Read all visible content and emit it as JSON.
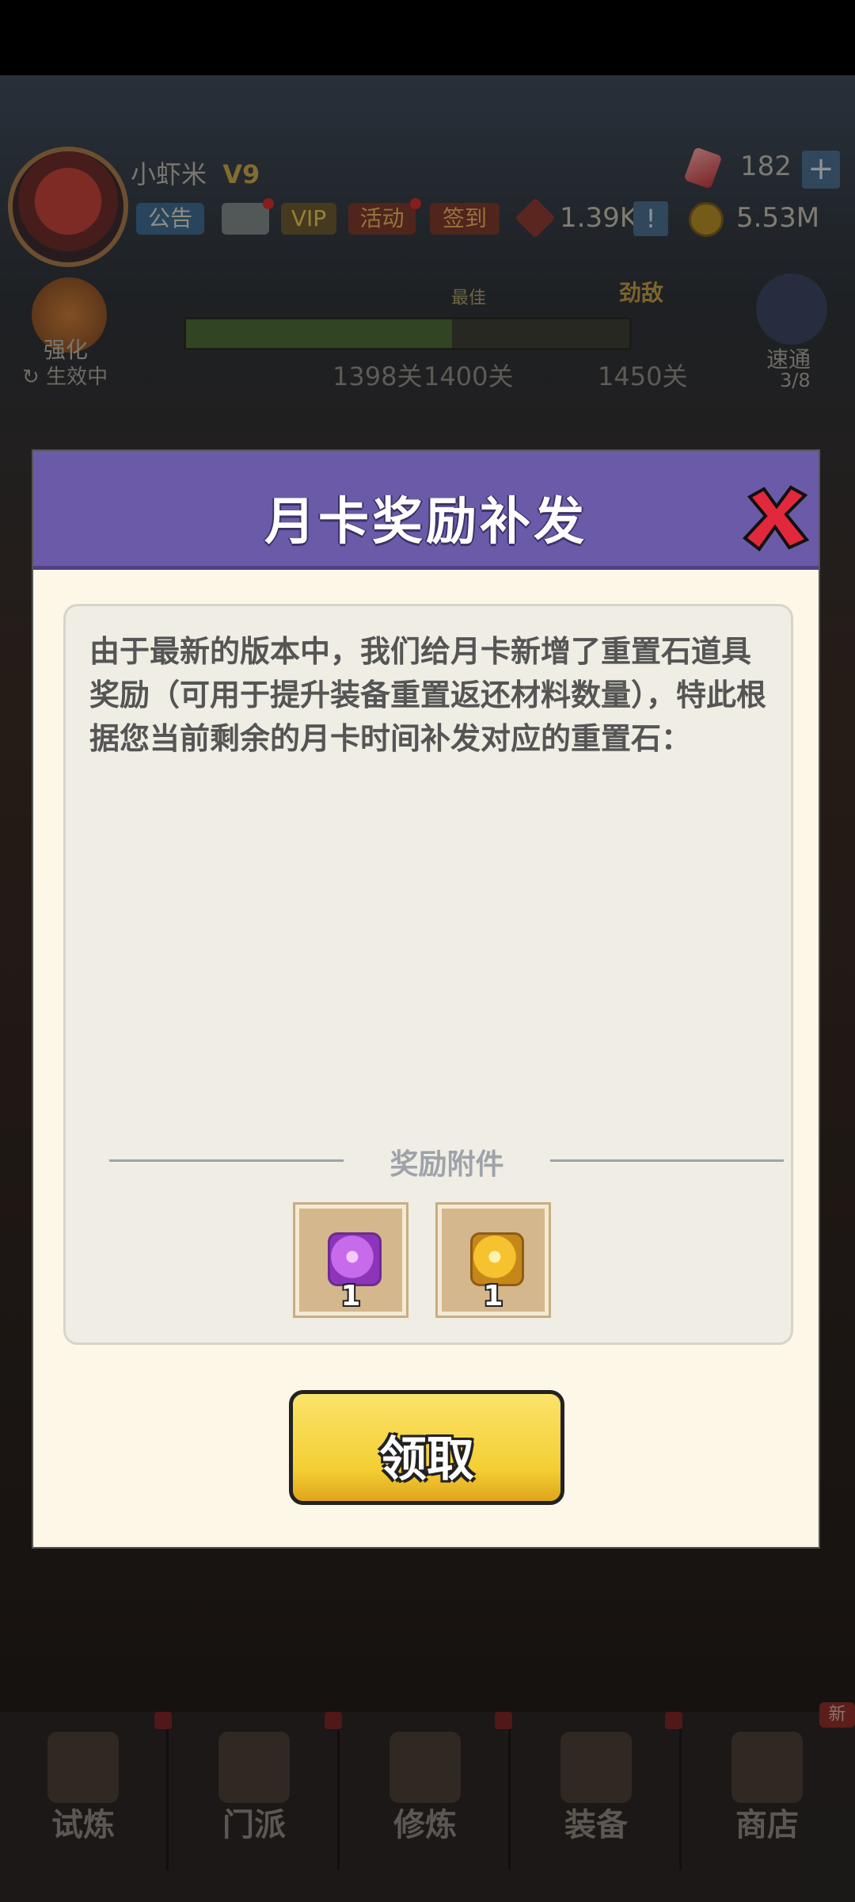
{
  "hud": {
    "player_name": "小虾米",
    "vip_level": "V9",
    "badges": {
      "notice": "公告",
      "vip": "VIP",
      "activity": "活动",
      "signin": "签到"
    },
    "gems": "182",
    "plus": "+",
    "power": "1.39K",
    "exclaim": "!",
    "coins": "5.53M",
    "left_button": {
      "label": "强化",
      "sub": "生效中"
    },
    "progress": {
      "best_label": "最佳",
      "rival_label": "劲敌",
      "level_current": "1398关",
      "level_best": "1400关",
      "level_rival": "1450关"
    },
    "right_button": {
      "label": "速通",
      "sub": "3/8"
    }
  },
  "modal": {
    "title": "月卡奖励补发",
    "message": "由于最新的版本中，我们给月卡新增了重置石道具奖励（可用于提升装备重置返还材料数量），特此根据您当前剩余的月卡时间补发对应的重置石：",
    "attachments_label": "奖励附件",
    "rewards": [
      {
        "icon": "purple-reset-stone-icon",
        "quantity": "1"
      },
      {
        "icon": "gold-reset-stone-icon",
        "quantity": "1"
      }
    ],
    "claim_label": "领取"
  },
  "nav": {
    "items": [
      {
        "label": "试炼"
      },
      {
        "label": "门派"
      },
      {
        "label": "修炼"
      },
      {
        "label": "装备"
      },
      {
        "label": "商店"
      }
    ],
    "new_badge": "新"
  }
}
